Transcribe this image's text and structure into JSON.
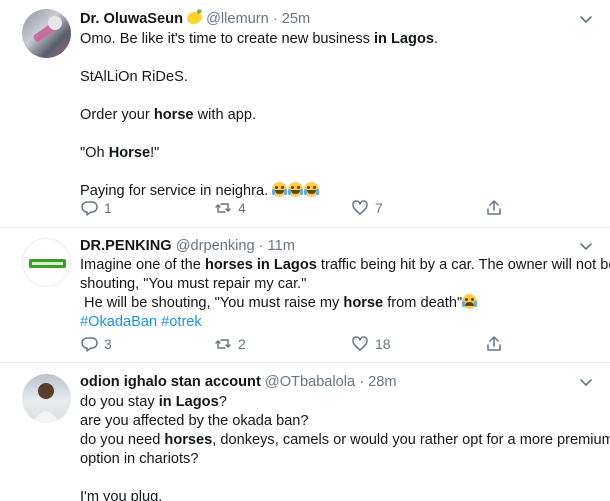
{
  "tweets": [
    {
      "name": "Dr. OluwaSeun",
      "handle": "@llemurn",
      "dot": "·",
      "time": "25m",
      "lines": [
        [
          {
            "t": "Omo. Be like it's time to create new business "
          },
          {
            "t": "in Lagos",
            "b": true
          },
          {
            "t": "."
          }
        ],
        [],
        [
          {
            "t": "StAlLiOn RiDeS."
          }
        ],
        [],
        [
          {
            "t": "Order your "
          },
          {
            "t": "horse",
            "b": true
          },
          {
            "t": " with app."
          }
        ],
        [],
        [
          {
            "t": "\"Oh "
          },
          {
            "t": "Horse",
            "b": true
          },
          {
            "t": "!\""
          }
        ],
        [],
        [
          {
            "t": "Paying for service in neighra. "
          },
          {
            "emoji": "laugh"
          },
          {
            "emoji": "laugh"
          },
          {
            "emoji": "laugh"
          }
        ]
      ],
      "replies": "1",
      "retweets": "4",
      "likes": "7"
    },
    {
      "name": "DR.PENKING",
      "handle": "@drpenking",
      "dot": "·",
      "time": "11m",
      "lines": [
        [
          {
            "t": "Imagine one of the "
          },
          {
            "t": "horses in Lagos",
            "b": true
          },
          {
            "t": " traffic being hit by a car. The owner will not be"
          }
        ],
        [
          {
            "t": "shouting, \"You must repair my car.\""
          }
        ],
        [
          {
            "t": " He will be shouting, \"You must raise my "
          },
          {
            "t": "horse",
            "b": true
          },
          {
            "t": " from death\""
          },
          {
            "emoji": "cry"
          }
        ],
        [
          {
            "t": "#OkadaBan",
            "h": true
          },
          {
            "t": " "
          },
          {
            "t": "#otrek",
            "h": true
          }
        ]
      ],
      "replies": "3",
      "retweets": "2",
      "likes": "18"
    },
    {
      "name": "odion ighalo stan account",
      "handle": "@OTbabalola",
      "dot": "·",
      "time": "28m",
      "lines": [
        [
          {
            "t": "do you stay "
          },
          {
            "t": "in Lagos",
            "b": true
          },
          {
            "t": "?"
          }
        ],
        [
          {
            "t": "are you affected by the okada ban?"
          }
        ],
        [
          {
            "t": "do you need "
          },
          {
            "t": "horses",
            "b": true
          },
          {
            "t": ", donkeys, camels or would you rather opt for a more premium"
          }
        ],
        [
          {
            "t": "option in chariots?"
          }
        ],
        [],
        [
          {
            "t": "I'm you plug."
          }
        ]
      ]
    }
  ],
  "icons": {
    "reply": "reply-icon",
    "retweet": "retweet-icon",
    "like": "heart-icon",
    "share": "share-icon",
    "more": "chevron-down-icon"
  },
  "colors": {
    "text": "#14171a",
    "muted": "#657786",
    "link": "#1b95e0",
    "divider": "#e6ecf0"
  }
}
